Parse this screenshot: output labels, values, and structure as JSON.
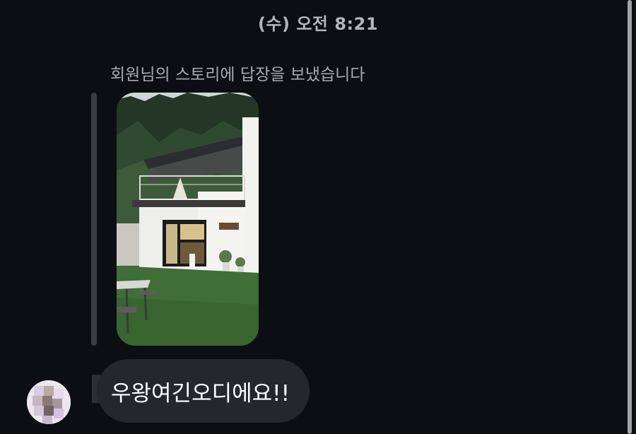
{
  "header": {
    "timestamp": "(수) 오전 8:21"
  },
  "story_reply": {
    "caption": "회원님의 스토리에 답장을 보냈습니다",
    "image_description_name": "story-house-photo"
  },
  "message": {
    "text": "우왕여긴오디에요!!"
  },
  "colors": {
    "background": "#0b0f13",
    "bubble": "#24282d",
    "caption_text": "#a6abb1",
    "timestamp_text": "#b2b6bc"
  }
}
